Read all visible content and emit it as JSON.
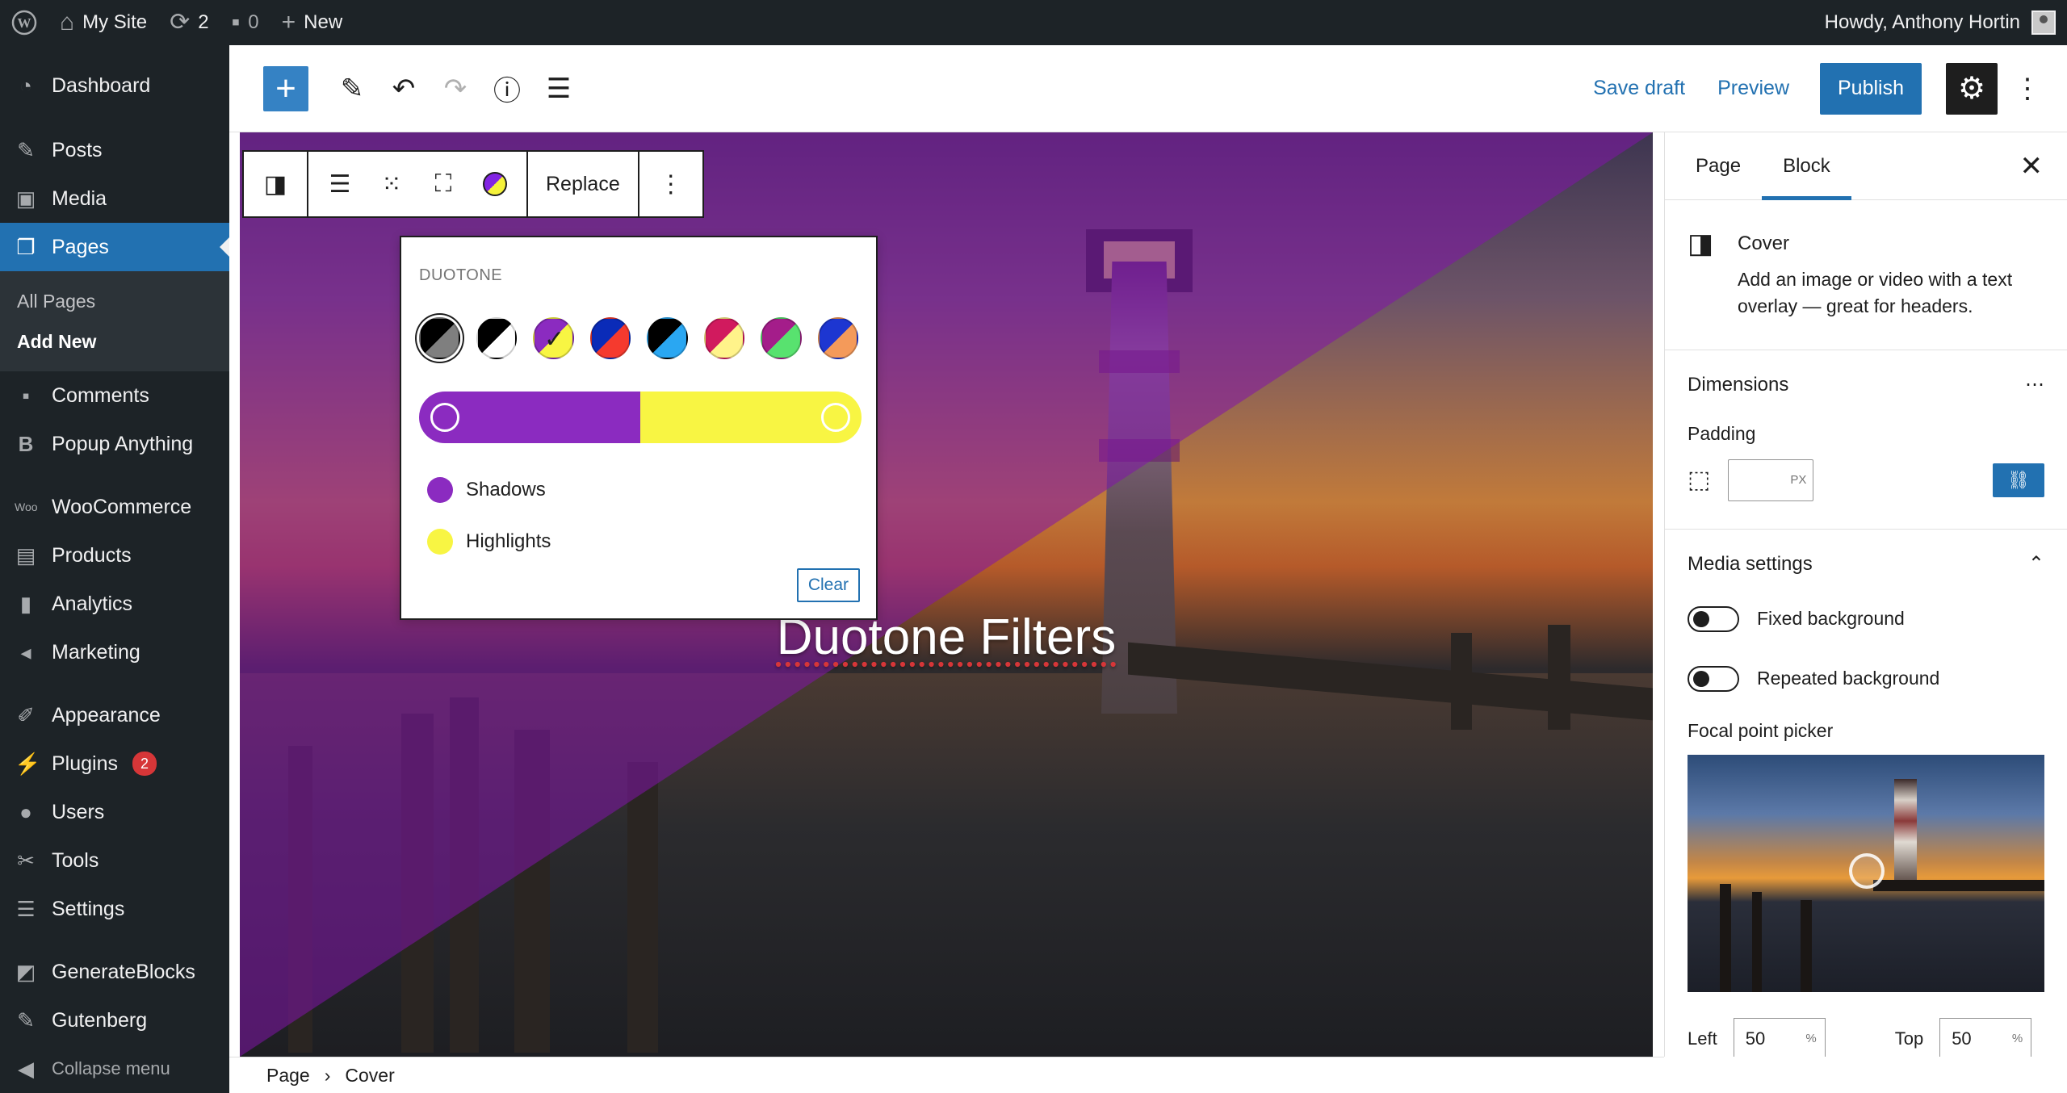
{
  "adminbar": {
    "site_name": "My Site",
    "updates_count": "2",
    "comments_count": "0",
    "new_label": "New",
    "howdy": "Howdy, Anthony Hortin"
  },
  "sidebar": {
    "items": [
      {
        "label": "Dashboard",
        "icon": "dashboard-icon"
      },
      {
        "label": "Posts",
        "icon": "pin-icon"
      },
      {
        "label": "Media",
        "icon": "media-icon"
      },
      {
        "label": "Pages",
        "icon": "page-icon"
      },
      {
        "label": "Comments",
        "icon": "comment-icon"
      },
      {
        "label": "Popup Anything",
        "icon": "b-icon"
      },
      {
        "label": "WooCommerce",
        "icon": "woo-icon"
      },
      {
        "label": "Products",
        "icon": "archive-icon"
      },
      {
        "label": "Analytics",
        "icon": "bar-chart-icon"
      },
      {
        "label": "Marketing",
        "icon": "megaphone-icon"
      },
      {
        "label": "Appearance",
        "icon": "paintbrush-icon"
      },
      {
        "label": "Plugins",
        "icon": "plug-icon"
      },
      {
        "label": "Users",
        "icon": "user-icon"
      },
      {
        "label": "Tools",
        "icon": "wrench-icon"
      },
      {
        "label": "Settings",
        "icon": "sliders-icon"
      },
      {
        "label": "GenerateBlocks",
        "icon": "blocks-icon"
      },
      {
        "label": "Gutenberg",
        "icon": "pencil-icon"
      },
      {
        "label": "Collapse menu",
        "icon": "collapse-icon"
      }
    ],
    "submenu": [
      "All Pages",
      "Add New"
    ],
    "plugins_badge": "2"
  },
  "header": {
    "save_draft": "Save draft",
    "preview": "Preview",
    "publish": "Publish"
  },
  "block_toolbar": {
    "replace": "Replace"
  },
  "duotone": {
    "title": "DUOTONE",
    "shadows_label": "Shadows",
    "highlights_label": "Highlights",
    "clear_label": "Clear",
    "shadow_color": "#8b2bc0",
    "highlight_color": "#f8f543"
  },
  "cover": {
    "title": "Duotone Filters"
  },
  "settings": {
    "tab_page": "Page",
    "tab_block": "Block",
    "block_name": "Cover",
    "block_desc": "Add an image or video with a text overlay — great for headers.",
    "dimensions": "Dimensions",
    "padding": "Padding",
    "padding_unit": "PX",
    "media_settings": "Media settings",
    "fixed_background": "Fixed background",
    "repeated_background": "Repeated background",
    "focal_point_picker": "Focal point picker",
    "left_label": "Left",
    "left_value": "50",
    "top_label": "Top",
    "top_value": "50",
    "percent": "%"
  },
  "breadcrumb": {
    "root": "Page",
    "current": "Cover"
  },
  "colors": {
    "accent": "#2271b1",
    "admin_bg": "#1d2327"
  }
}
